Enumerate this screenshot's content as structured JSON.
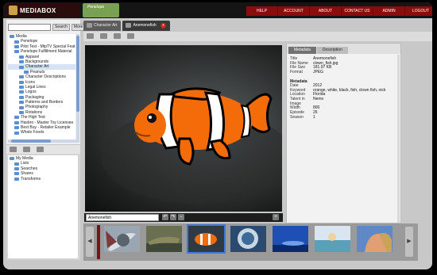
{
  "header": {
    "logo_text": "MEDIABOX",
    "brand_text": "Penelope",
    "nav": [
      "HELP",
      "ACCOUNT",
      "ABOUT",
      "CONTACT US",
      "ADMIN",
      "LOGOUT"
    ]
  },
  "search": {
    "value": "",
    "search_label": "Search",
    "more_label": "More"
  },
  "tree": [
    {
      "label": "Media",
      "level": 0
    },
    {
      "label": "Penelope",
      "level": 1
    },
    {
      "label": "Pilot Test - MtpTV Special Feat",
      "level": 1
    },
    {
      "label": "Penelope Fulfillment Material",
      "level": 1
    },
    {
      "label": "Apparel",
      "level": 2
    },
    {
      "label": "Backgrounds",
      "level": 2
    },
    {
      "label": "Character Art",
      "level": 2,
      "selected": true
    },
    {
      "label": "Peanuts",
      "level": 3
    },
    {
      "label": "Character Descriptions",
      "level": 2
    },
    {
      "label": "Icons",
      "level": 2
    },
    {
      "label": "Legal Lines",
      "level": 2
    },
    {
      "label": "Logos",
      "level": 2
    },
    {
      "label": "Packaging",
      "level": 2
    },
    {
      "label": "Patterns and Borders",
      "level": 2
    },
    {
      "label": "Photography",
      "level": 2
    },
    {
      "label": "Rotations",
      "level": 2
    },
    {
      "label": "The High Test",
      "level": 1
    },
    {
      "label": "Hasbro - Master Toy Licensee",
      "level": 1
    },
    {
      "label": "Best Buy - Retailer Example",
      "level": 1
    },
    {
      "label": "Whole Foods",
      "level": 1
    }
  ],
  "my_media": [
    {
      "label": "My Media",
      "level": 0
    },
    {
      "label": "Lists",
      "level": 1
    },
    {
      "label": "Searches",
      "level": 1
    },
    {
      "label": "Shares",
      "level": 1
    },
    {
      "label": "Transforms",
      "level": 1
    }
  ],
  "tabs": [
    {
      "label": "Character Art",
      "active": false
    },
    {
      "label": "Anemonefish",
      "active": true,
      "close": "x"
    }
  ],
  "caption": {
    "value": "Anemonefish"
  },
  "meta_tabs": [
    "Metadata",
    "Description"
  ],
  "metadata": {
    "top": [
      {
        "k": "Title",
        "v": "Anemonefish"
      },
      {
        "k": "File Name",
        "v": "clown_fish.jpg"
      },
      {
        "k": "File Size",
        "v": "181.97 KB"
      },
      {
        "k": "Format",
        "v": "JPEG"
      }
    ],
    "section": "Metadata",
    "details": [
      {
        "k": "Date",
        "v": "2012"
      },
      {
        "k": "Keyword",
        "v": "orange, white, black, fish, clown fish, nick"
      },
      {
        "k": "Location",
        "v": "Florida"
      },
      {
        "k": "Talent in Image",
        "v": "Nemo"
      },
      {
        "k": "Width",
        "v": "800"
      },
      {
        "k": "Episode",
        "v": "26"
      },
      {
        "k": "Season",
        "v": "1"
      }
    ]
  },
  "thumbnails": [
    {
      "name": "thumb-abstract"
    },
    {
      "name": "thumb-crocodile"
    },
    {
      "name": "thumb-clownfish",
      "selected": true
    },
    {
      "name": "thumb-underwater-diver"
    },
    {
      "name": "thumb-blue-sky"
    },
    {
      "name": "thumb-sunset-beach"
    },
    {
      "name": "thumb-face-portrait"
    }
  ],
  "colors": {
    "nav_red": "#8a0d0d",
    "fish_orange": "#f46b0a",
    "accent_blue": "#3f78d8"
  }
}
